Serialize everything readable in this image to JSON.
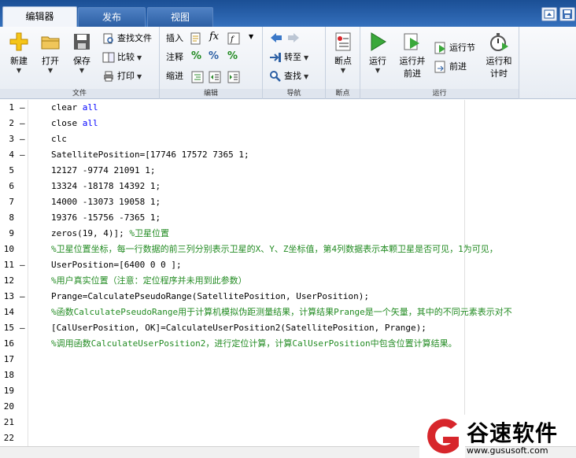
{
  "tabs": [
    {
      "label": "编辑器",
      "active": true
    },
    {
      "label": "发布",
      "active": false
    },
    {
      "label": "视图",
      "active": false
    }
  ],
  "ribbon": {
    "file": {
      "group_label": "文件",
      "new_label": "新建",
      "open_label": "打开",
      "save_label": "保存",
      "find_files_label": "查找文件",
      "compare_label": "比较",
      "print_label": "打印"
    },
    "edit": {
      "group_label": "编辑",
      "insert_label": "插入",
      "fx_label": "fx",
      "comment_label": "注释",
      "indent_label": "缩进"
    },
    "navigate": {
      "group_label": "导航",
      "goto_label": "转至",
      "find_label": "查找"
    },
    "breakpoints": {
      "group_label": "断点",
      "breakpoints_label": "断点"
    },
    "run": {
      "group_label": "运行",
      "run_label": "运行",
      "run_advance_label_1": "运行并",
      "run_advance_label_2": "前进",
      "run_section_label": "运行节",
      "advance_label": "前进",
      "run_time_label_1": "运行和",
      "run_time_label_2": "计时"
    }
  },
  "editor": {
    "lines": [
      {
        "n": "1",
        "dash": "–",
        "parts": [
          {
            "t": "clear ",
            "c": ""
          },
          {
            "t": "all",
            "c": "kw"
          }
        ]
      },
      {
        "n": "2",
        "dash": "–",
        "parts": [
          {
            "t": "close ",
            "c": ""
          },
          {
            "t": "all",
            "c": "kw"
          }
        ]
      },
      {
        "n": "3",
        "dash": "–",
        "parts": [
          {
            "t": "clc",
            "c": ""
          }
        ]
      },
      {
        "n": "4",
        "dash": "–",
        "parts": [
          {
            "t": "SatellitePosition=[17746 17572 7365 1;",
            "c": ""
          }
        ]
      },
      {
        "n": "5",
        "dash": "",
        "parts": [
          {
            "t": "12127 -9774 21091 1;",
            "c": ""
          }
        ]
      },
      {
        "n": "6",
        "dash": "",
        "parts": [
          {
            "t": "13324 -18178 14392 1;",
            "c": ""
          }
        ]
      },
      {
        "n": "7",
        "dash": "",
        "parts": [
          {
            "t": "14000 -13073 19058 1;",
            "c": ""
          }
        ]
      },
      {
        "n": "8",
        "dash": "",
        "parts": [
          {
            "t": "19376 -15756 -7365 1;",
            "c": ""
          }
        ]
      },
      {
        "n": "9",
        "dash": "",
        "parts": [
          {
            "t": "zeros(19, 4)]; ",
            "c": ""
          },
          {
            "t": "%卫星位置",
            "c": "cm"
          }
        ]
      },
      {
        "n": "10",
        "dash": "",
        "parts": [
          {
            "t": "%卫星位置坐标，每一行数据的前三列分别表示卫星的X、Y、Z坐标值，第4列数据表示本颗卫星是否可见，1为可见，",
            "c": "cm"
          }
        ]
      },
      {
        "n": "11",
        "dash": "–",
        "parts": [
          {
            "t": "UserPosition=[6400 0 0 ];",
            "c": ""
          }
        ]
      },
      {
        "n": "12",
        "dash": "",
        "parts": [
          {
            "t": "%用户真实位置（注意：定位程序并未用到此参数）",
            "c": "cm"
          }
        ]
      },
      {
        "n": "13",
        "dash": "–",
        "parts": [
          {
            "t": "Prange=CalculatePseudoRange(SatellitePosition, UserPosition);",
            "c": ""
          }
        ]
      },
      {
        "n": "14",
        "dash": "",
        "parts": [
          {
            "t": "%函数CalculatePseudoRange用于计算机模拟伪距测量结果，计算结果Prange是一个矢量，其中的不同元素表示对不",
            "c": "cm"
          }
        ]
      },
      {
        "n": "15",
        "dash": "–",
        "parts": [
          {
            "t": "[CalUserPosition, OK]=CalculateUserPosition2(SatellitePosition, Prange);",
            "c": ""
          }
        ]
      },
      {
        "n": "16",
        "dash": "",
        "parts": [
          {
            "t": "%调用函数CalculateUserPosition2，进行定位计算，计算CalUserPosition中包含位置计算结果。",
            "c": "cm"
          }
        ]
      },
      {
        "n": "17",
        "dash": "",
        "parts": []
      },
      {
        "n": "18",
        "dash": "",
        "parts": []
      },
      {
        "n": "19",
        "dash": "",
        "parts": []
      },
      {
        "n": "20",
        "dash": "",
        "parts": []
      },
      {
        "n": "21",
        "dash": "",
        "parts": []
      },
      {
        "n": "22",
        "dash": "",
        "parts": []
      }
    ]
  },
  "watermark": {
    "name": "谷速软件",
    "url": "www.gususoft.com"
  },
  "colors": {
    "keyword": "#0000ff",
    "comment": "#228b22",
    "tab_bar": "#2a63ad",
    "watermark_red": "#d7262b"
  }
}
